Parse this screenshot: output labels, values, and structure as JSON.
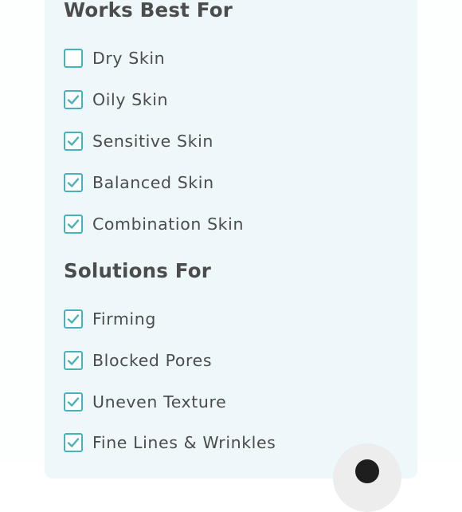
{
  "sections": [
    {
      "title": "Works Best For",
      "items": [
        {
          "label": "Dry Skin",
          "checked": false
        },
        {
          "label": "Oily Skin",
          "checked": true
        },
        {
          "label": "Sensitive Skin",
          "checked": true
        },
        {
          "label": "Balanced Skin",
          "checked": true
        },
        {
          "label": "Combination Skin",
          "checked": true
        }
      ]
    },
    {
      "title": "Solutions For",
      "items": [
        {
          "label": "Firming",
          "checked": true
        },
        {
          "label": "Blocked Pores",
          "checked": true
        },
        {
          "label": "Uneven Texture",
          "checked": true
        },
        {
          "label": "Fine Lines & Wrinkles",
          "checked": true
        }
      ]
    }
  ],
  "icons": {
    "check": "check-icon",
    "chat": "chat-icon"
  },
  "colors": {
    "accent": "#46b2b9",
    "text": "#4c4c4c",
    "panel": "#eef8fa"
  }
}
